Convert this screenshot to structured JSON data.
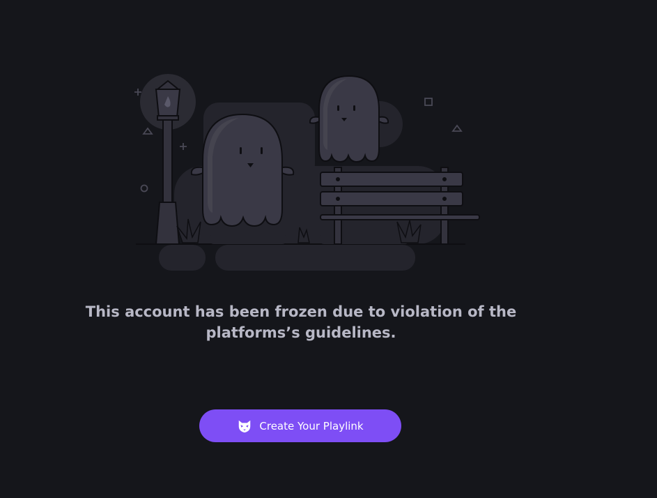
{
  "illustration": {
    "name": "ghost-park-illustration",
    "colors": {
      "background": "#15161b",
      "shape": "#24242c",
      "ghost": "#3a3946",
      "ghost_shadow": "#2e2d38",
      "outline": "#0e0e12",
      "bench": "#3a3946",
      "lamp_glow": "#2b2b33"
    }
  },
  "message": {
    "line1": "This account has been frozen due to violation of the",
    "line2": "platforms’s guidelines."
  },
  "cta": {
    "label": "Create Your Playlink",
    "icon": "cat-mask-icon",
    "color": "#7e4ef5"
  }
}
